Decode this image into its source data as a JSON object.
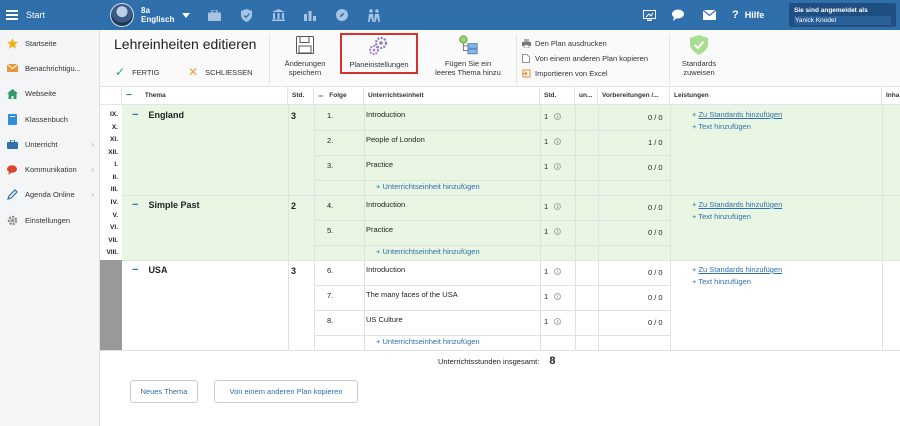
{
  "topbar": {
    "start_label": "Start",
    "class_line1": "8a",
    "class_line2": "Englisch",
    "icons": [
      "briefcase-icon",
      "shield-icon",
      "bank-icon",
      "bar-chart-icon",
      "compass-icon",
      "people-icon"
    ],
    "help_label": "Hilfe",
    "login_label": "Sie sind angemeldet als",
    "login_user": "Yanick Knodel",
    "accent": "#2f6fab"
  },
  "sidebar": {
    "items": [
      {
        "label": "Startseite",
        "icon": "star-icon",
        "arrow": false
      },
      {
        "label": "Benachrichtigu...",
        "icon": "envelope-icon",
        "arrow": false
      },
      {
        "label": "Webseite",
        "icon": "home-icon",
        "arrow": false
      },
      {
        "label": "Klassenbuch",
        "icon": "book-icon",
        "arrow": false
      },
      {
        "label": "Unterricht",
        "icon": "briefcase-icon",
        "arrow": true
      },
      {
        "label": "Kommunikation",
        "icon": "chat-icon",
        "arrow": true
      },
      {
        "label": "Agenda Online",
        "icon": "pencil-icon",
        "arrow": true
      },
      {
        "label": "Einstellungen",
        "icon": "gear-icon",
        "arrow": false
      }
    ]
  },
  "toolbar": {
    "title": "Lehreinheiten editieren",
    "done_label": "FERTIG",
    "close_label": "SCHLIESSEN",
    "save_label_1": "Änderungen",
    "save_label_2": "speichern",
    "plan_settings_label": "Planeinstellungen",
    "add_topic_1": "Fügen Sie ein",
    "add_topic_2": "leeres Thema hinzu",
    "print_label": "Den Plan ausdrucken",
    "copy_label": "Von einem anderen Plan kopieren",
    "excel_label": "Importieren von Excel",
    "standards_1": "Standards",
    "standards_2": "zuweisen"
  },
  "table": {
    "headers": {
      "thema": "Thema",
      "std": "Std.",
      "folge": "Folge",
      "unit": "Unterrichtseinheit",
      "std2": "Std.",
      "un": "un...",
      "prep": "Vorbereitungen /...",
      "leistungen": "Leistungen",
      "inhalt": "Inha"
    },
    "topics": [
      {
        "name": "England",
        "hours": "3",
        "months": [
          "IX.",
          "X.",
          "XI.",
          "XII.",
          "I.",
          "II.",
          "III."
        ],
        "units": [
          {
            "num": "1.",
            "title": "Introduction",
            "hours": "1",
            "prep": "0 / 0"
          },
          {
            "num": "2.",
            "title": "People of London",
            "hours": "1",
            "prep": "1 / 0"
          },
          {
            "num": "3.",
            "title": "Practice",
            "hours": "1",
            "prep": "0 / 0"
          }
        ]
      },
      {
        "name": "Simple Past",
        "hours": "2",
        "months": [
          "IV.",
          "V.",
          "VI.",
          "VII.",
          "VIII."
        ],
        "units": [
          {
            "num": "4.",
            "title": "Introduction",
            "hours": "1",
            "prep": "0 / 0"
          },
          {
            "num": "5.",
            "title": "Practice",
            "hours": "1",
            "prep": "0 / 0"
          }
        ]
      },
      {
        "name": "USA",
        "hours": "3",
        "months": [],
        "units": [
          {
            "num": "6.",
            "title": "Introduction",
            "hours": "1",
            "prep": "0 / 0"
          },
          {
            "num": "7.",
            "title": "The many faces of the USA",
            "hours": "1",
            "prep": "0 / 0"
          },
          {
            "num": "8.",
            "title": "US Culture",
            "hours": "1",
            "prep": "0 / 0"
          }
        ]
      }
    ],
    "add_unit_label": "Unterrichtseinheit hinzufügen",
    "add_standards_label": "Zu Standards hinzufügen",
    "add_text_label": "Text hinzufügen"
  },
  "footer": {
    "total_label": "Unterrichtsstunden insgesamt:",
    "total_value": "8",
    "new_topic_label": "Neues Thema",
    "copy_plan_label": "Von einem anderen Plan kopieren"
  }
}
